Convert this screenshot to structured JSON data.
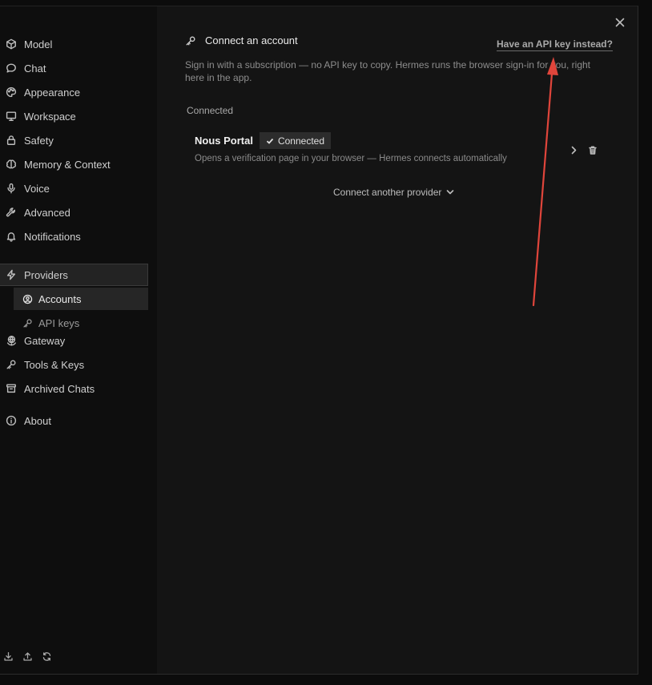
{
  "sidebar": {
    "items": [
      {
        "label": "Model",
        "icon": "cube-icon"
      },
      {
        "label": "Chat",
        "icon": "chat-bubble-icon"
      },
      {
        "label": "Appearance",
        "icon": "palette-icon"
      },
      {
        "label": "Workspace",
        "icon": "monitor-icon"
      },
      {
        "label": "Safety",
        "icon": "lock-icon"
      },
      {
        "label": "Memory & Context",
        "icon": "brain-icon"
      },
      {
        "label": "Voice",
        "icon": "microphone-icon"
      },
      {
        "label": "Advanced",
        "icon": "wrench-icon"
      },
      {
        "label": "Notifications",
        "icon": "bell-icon"
      },
      {
        "label": "Providers",
        "icon": "lightning-icon",
        "active": true
      },
      {
        "label": "Gateway",
        "icon": "globe-icon"
      },
      {
        "label": "Tools & Keys",
        "icon": "key-icon"
      },
      {
        "label": "Archived Chats",
        "icon": "archive-icon"
      },
      {
        "label": "About",
        "icon": "info-icon"
      }
    ],
    "sub_items": [
      {
        "label": "Accounts",
        "icon": "user-circle-icon",
        "active": true
      },
      {
        "label": "API keys",
        "icon": "key-icon"
      }
    ],
    "footer_icons": [
      "download-icon",
      "upload-icon",
      "refresh-icon"
    ]
  },
  "main": {
    "title": "Connect an account",
    "api_link": "Have an API key instead?",
    "description": "Sign in with a subscription — no API key to copy. Hermes runs the browser sign-in for you, right here in the app.",
    "section_label": "Connected",
    "provider": {
      "name": "Nous Portal",
      "badge": "Connected",
      "subtitle": "Opens a verification page in your browser — Hermes connects automatically"
    },
    "connect_another": "Connect another provider"
  },
  "colors": {
    "background": "#141414",
    "sidebar": "#0e0e0e",
    "annotation_arrow": "#e0453b"
  }
}
